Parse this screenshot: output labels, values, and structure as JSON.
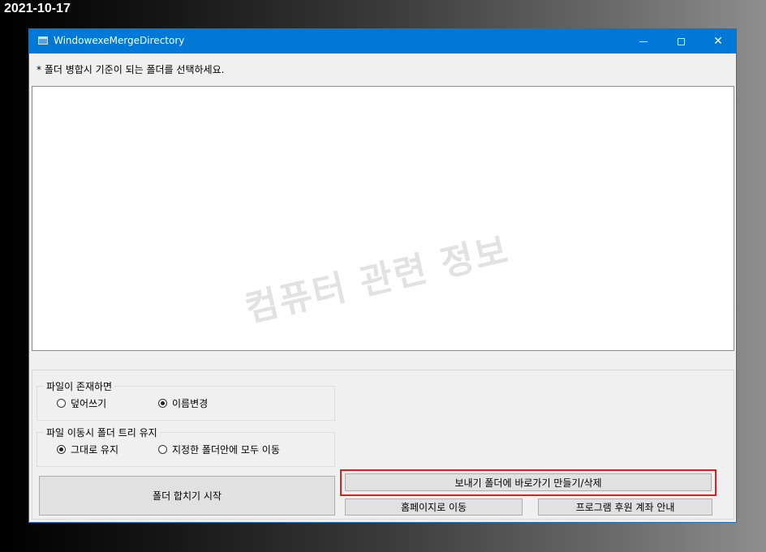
{
  "date_label": "2021-10-17",
  "window": {
    "title": "WindowexeMergeDirectory",
    "icon": "app-window-icon",
    "minimize_icon": "minimize-icon",
    "maximize_icon": "maximize-icon",
    "close_glyph": "✕"
  },
  "instruction": "* 폴더 병합시 기준이 되는 폴더를 선택하세요.",
  "watermark": "컴퓨터 관련 정보",
  "groups": {
    "file_exists": {
      "legend": "파일이 존재하면",
      "options": [
        {
          "label": "덮어쓰기",
          "checked": false
        },
        {
          "label": "이름변경",
          "checked": true
        }
      ]
    },
    "folder_tree": {
      "legend": "파일 이동시 폴더 트리 유지",
      "options": [
        {
          "label": "그대로 유지",
          "checked": true
        },
        {
          "label": "지정한 폴더안에 모두 이동",
          "checked": false
        }
      ]
    }
  },
  "buttons": {
    "start": "폴더 합치기 시작",
    "shortcut": "보내기 폴더에 바로가기 만들기/삭제",
    "homepage": "홈페이지로 이동",
    "donate": "프로그램 후원 계좌 안내"
  },
  "colors": {
    "titlebar": "#0078d7",
    "highlight": "#e02020"
  }
}
